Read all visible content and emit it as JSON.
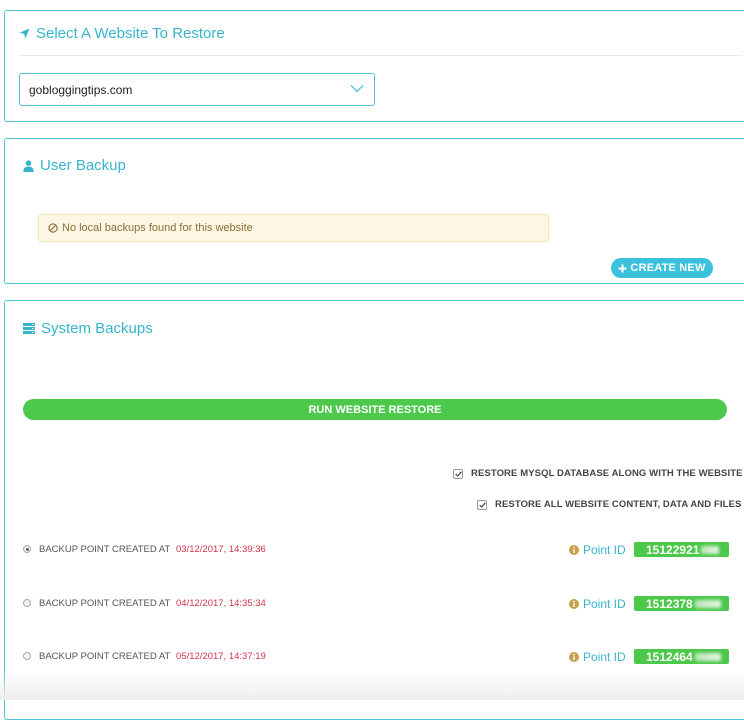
{
  "select_website": {
    "title": "Select A Website To Restore",
    "selected_value": "gobloggingtips.com"
  },
  "user_backup": {
    "title": "User Backup",
    "alert_text": "No local backups found for this website",
    "create_button_label": "CREATE NEW"
  },
  "system_backups": {
    "title": "System Backups",
    "run_button_label": "RUN WEBSITE RESTORE",
    "options": [
      {
        "label": "RESTORE MYSQL DATABASE ALONG WITH THE WEBSITE",
        "checked": true
      },
      {
        "label": "RESTORE ALL WEBSITE CONTENT, DATA AND FILES",
        "checked": true
      }
    ],
    "points": [
      {
        "label": "BACKUP POINT CREATED AT",
        "date": "03/12/2017, 14:39:36",
        "point_id_label": "Point ID",
        "point_id": "15122921",
        "selected": true
      },
      {
        "label": "BACKUP POINT CREATED AT",
        "date": "04/12/2017, 14:35:34",
        "point_id_label": "Point ID",
        "point_id": "1512378",
        "selected": false
      },
      {
        "label": "BACKUP POINT CREATED AT",
        "date": "05/12/2017, 14:37:19",
        "point_id_label": "Point ID",
        "point_id": "1512464",
        "selected": false
      }
    ]
  },
  "colors": {
    "accent": "#37b5cc",
    "success": "#4cc84a",
    "date_red": "#d2334a",
    "warning_bg": "#fcf7e3"
  }
}
